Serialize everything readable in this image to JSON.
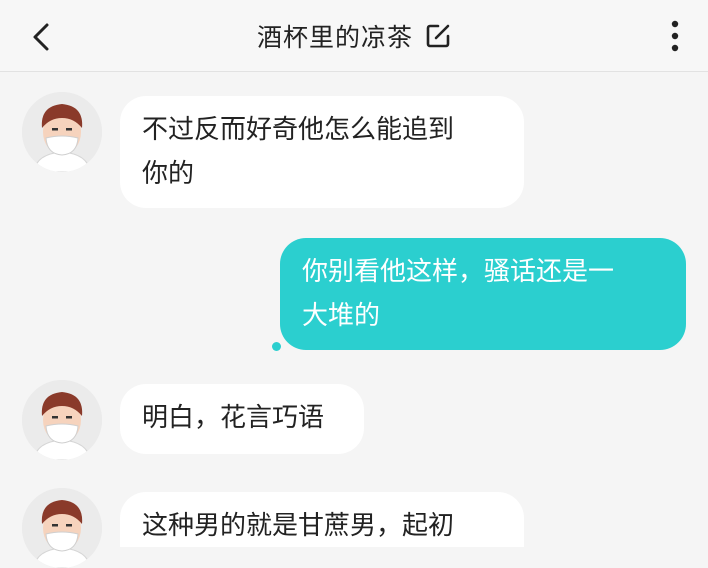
{
  "header": {
    "title": "酒杯里的凉茶",
    "back_icon": "chevron-left-icon",
    "edit_icon": "edit-icon",
    "more_icon": "more-vertical-icon"
  },
  "colors": {
    "accent": "#2bcfcf",
    "incoming_bubble": "#ffffff",
    "background": "#f5f5f5"
  },
  "messages": [
    {
      "side": "incoming",
      "lines": [
        "不过反而好奇他怎么能追到",
        "你的"
      ]
    },
    {
      "side": "outgoing",
      "lines": [
        "你别看他这样，骚话还是一",
        "大堆的"
      ]
    },
    {
      "side": "incoming",
      "lines": [
        "明白，花言巧语"
      ]
    },
    {
      "side": "incoming",
      "lines": [
        "这种男的就是甘蔗男，起初"
      ]
    }
  ]
}
